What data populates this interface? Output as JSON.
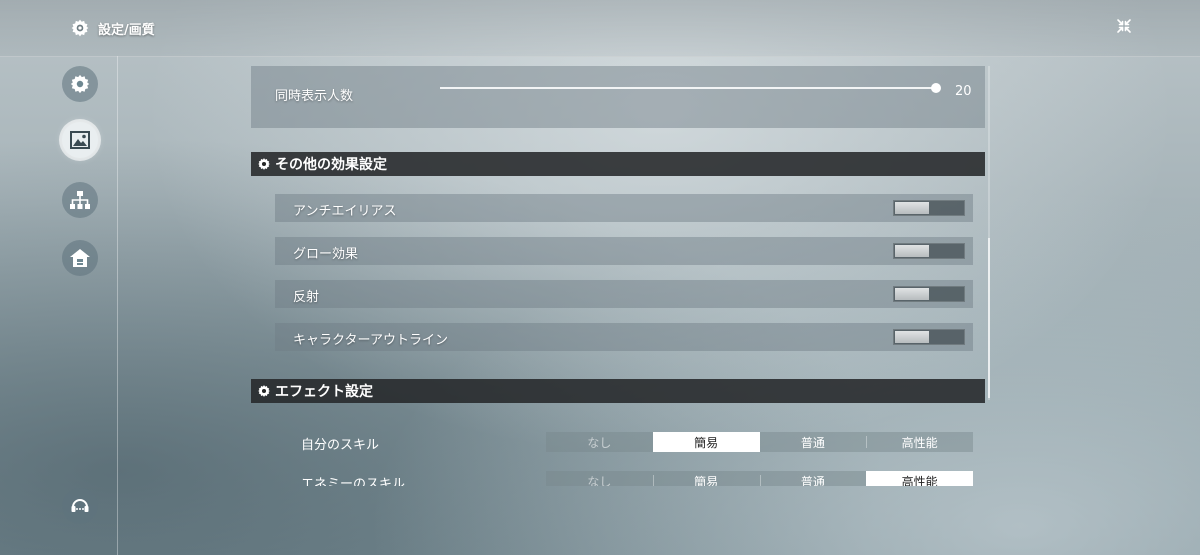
{
  "header": {
    "title": "設定/画質",
    "settings_icon": "gear-icon",
    "close_icon": "collapse-arrows-icon"
  },
  "sidebar": {
    "items": [
      {
        "icon": "gear-icon",
        "active": false
      },
      {
        "icon": "image-icon",
        "active": true
      },
      {
        "icon": "network-icon",
        "active": false
      },
      {
        "icon": "home-icon",
        "active": false
      },
      {
        "icon": "support-chat-icon",
        "active": false
      }
    ]
  },
  "content": {
    "display_count": {
      "label": "同時表示人数",
      "value": "20",
      "fill_fraction": 1.0
    },
    "other_effects": {
      "title": "その他の効果設定",
      "items": [
        {
          "label": "アンチエイリアス",
          "on": false
        },
        {
          "label": "グロー効果",
          "on": false
        },
        {
          "label": "反射",
          "on": false
        },
        {
          "label": "キャラクターアウトライン",
          "on": false
        }
      ]
    },
    "effect_settings": {
      "title": "エフェクト設定",
      "rows": [
        {
          "label": "自分のスキル",
          "options": [
            "なし",
            "簡易",
            "普通",
            "高性能"
          ],
          "selected": 1
        },
        {
          "label": "エネミーのスキル",
          "options": [
            "なし",
            "簡易",
            "普通",
            "高性能"
          ],
          "selected": 3
        }
      ]
    }
  },
  "colors": {
    "section_header_bg": "#262828",
    "selected_option_bg": "#ffffff"
  }
}
